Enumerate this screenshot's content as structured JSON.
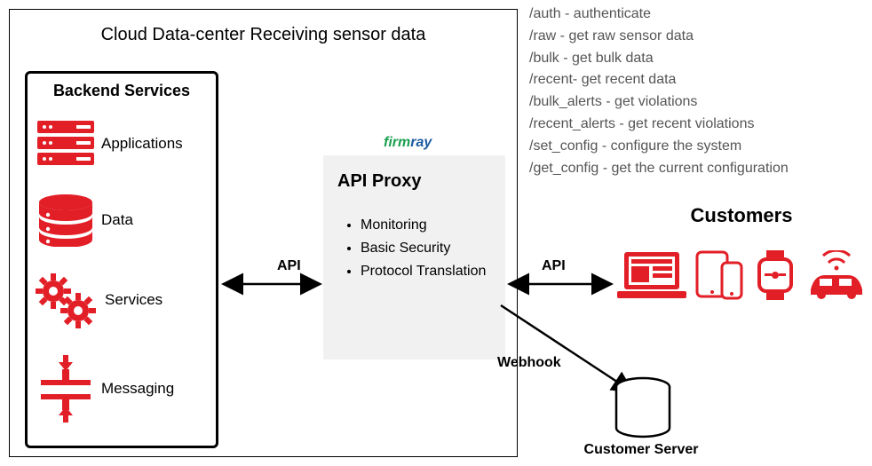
{
  "outer_title": "Cloud Data-center Receiving sensor data",
  "backend": {
    "title": "Backend Services",
    "items": [
      {
        "label": "Applications",
        "icon": "servers-icon"
      },
      {
        "label": "Data",
        "icon": "database-icon"
      },
      {
        "label": "Services",
        "icon": "gears-icon"
      },
      {
        "label": "Messaging",
        "icon": "messaging-icon"
      }
    ]
  },
  "firmray": {
    "part1": "firm",
    "part2": "ray"
  },
  "api_proxy": {
    "title": "API Proxy",
    "bullets": [
      "Monitoring",
      "Basic Security",
      "Protocol Translation"
    ]
  },
  "arrows": {
    "backend_to_proxy": "API",
    "proxy_to_customers": "API",
    "proxy_to_server": "Webhook"
  },
  "customers_title": "Customers",
  "customer_server_label": "Customer Server",
  "devices": [
    "laptop-icon",
    "tablet-phone-icon",
    "watch-icon",
    "car-wifi-icon"
  ],
  "endpoints": [
    {
      "path": "/auth",
      "desc": "authenticate"
    },
    {
      "path": "/raw",
      "desc": "get raw sensor data"
    },
    {
      "path": "/bulk",
      "desc": "get bulk data"
    },
    {
      "path": "/recent",
      "desc": "get recent data",
      "sep": "- "
    },
    {
      "path": "/bulk_alerts",
      "desc": "get violations"
    },
    {
      "path": "/recent_alerts",
      "desc": "get recent violations"
    },
    {
      "path": "/set_config",
      "desc": "configure the system"
    },
    {
      "path": "/get_config",
      "desc": "get the current configuration"
    }
  ],
  "colors": {
    "red": "#E21E26",
    "grey_text": "#555555",
    "box_grey": "#f1f1f1"
  }
}
